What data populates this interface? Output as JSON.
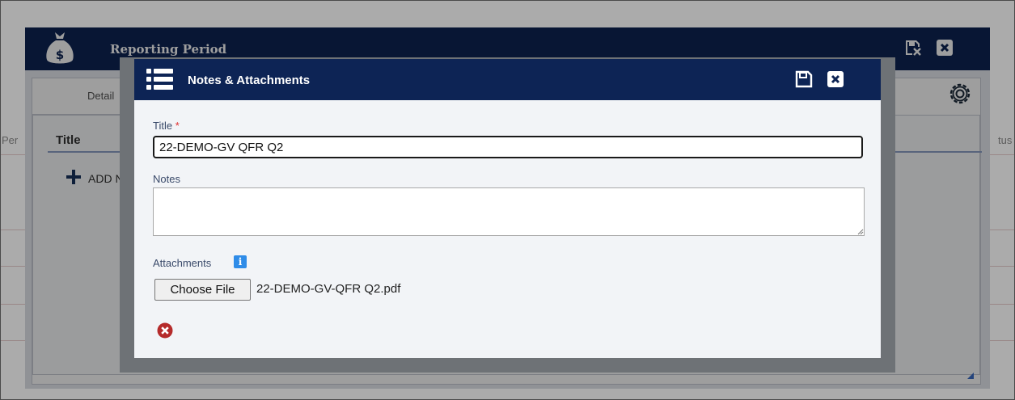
{
  "background": {
    "left_fragment": "Per",
    "right_fragment": "tus"
  },
  "reporting_period": {
    "title": "Reporting Period",
    "tab_label": "Detail",
    "column_title": "Title",
    "add_label": "ADD N"
  },
  "modal": {
    "title": "Notes & Attachments",
    "title_field_label": "Title",
    "required_marker": "*",
    "title_value": "22-DEMO-GV QFR Q2",
    "notes_label": "Notes",
    "notes_value": "",
    "attachments_label": "Attachments",
    "info_glyph": "i",
    "choose_file_label": "Choose File",
    "attached_file": "22-DEMO-GV-QFR Q2.pdf"
  },
  "colors": {
    "header_navy": "#0d2455",
    "required_red": "#e03030",
    "remove_red": "#b52b2b",
    "info_blue": "#2f8ce8"
  },
  "icons": [
    "money-bag-icon",
    "save-close-icon",
    "close-icon",
    "gear-icon",
    "plus-icon",
    "list-icon",
    "save-icon",
    "info-icon",
    "remove-icon",
    "resize-grip-icon"
  ]
}
